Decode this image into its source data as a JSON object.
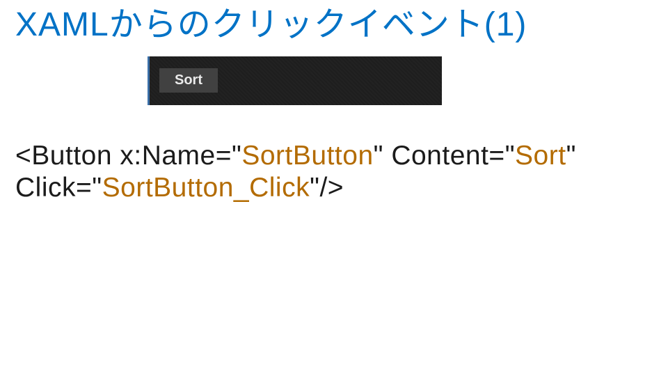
{
  "title": "XAMLからのクリックイベント(1)",
  "ui": {
    "button_label": "Sort"
  },
  "code": {
    "p1": "<Button x:Name=\"",
    "s1": "SortButton",
    "p2": "\" Content=\"",
    "s2": "Sort",
    "p3": "\"",
    "p4": "Click=\"",
    "s3": "SortButton_Click",
    "p5": "\"/>"
  }
}
